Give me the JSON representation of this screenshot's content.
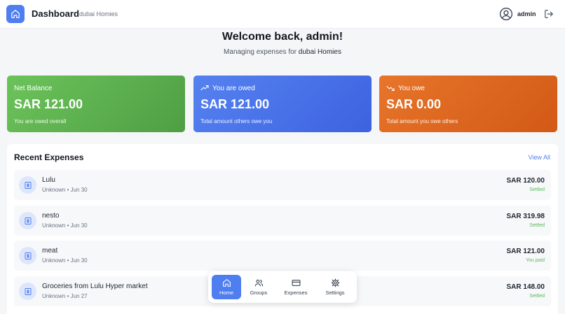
{
  "header": {
    "title": "Dashboard",
    "group_name": "dubai Homies",
    "user_name": "admin"
  },
  "welcome": {
    "heading": "Welcome back, admin!",
    "managing_prefix": "Managing expenses for",
    "group_name": "dubai Homies"
  },
  "cards": [
    {
      "title": "Net Balance",
      "amount": "SAR 121.00",
      "subtitle": "You are owed overall",
      "color": "#5cb050"
    },
    {
      "title": "You are owed",
      "amount": "SAR 121.00",
      "subtitle": "Total amount others owe you",
      "icon": "trending-up-icon",
      "color": "#4a73ea"
    },
    {
      "title": "You owe",
      "amount": "SAR 0.00",
      "subtitle": "Total amount you owe others",
      "icon": "trending-down-icon",
      "color": "#dd661f"
    }
  ],
  "recent": {
    "title": "Recent Expenses",
    "view_all": "View All",
    "items": [
      {
        "name": "Lulu",
        "payer": "Unknown",
        "date": "Jun 30",
        "amount": "SAR 120.00",
        "status": "Settled"
      },
      {
        "name": "nesto",
        "payer": "Unknown",
        "date": "Jun 30",
        "amount": "SAR 319.98",
        "status": "Settled"
      },
      {
        "name": "meat",
        "payer": "Unknown",
        "date": "Jun 30",
        "amount": "SAR 121.00",
        "status": "You paid"
      },
      {
        "name": "Groceries from Lulu Hyper market",
        "payer": "Unknown",
        "date": "Jun 27",
        "amount": "SAR 148.00",
        "status": "Settled"
      }
    ]
  },
  "nav": [
    {
      "label": "Home",
      "icon": "home-icon",
      "active": true
    },
    {
      "label": "Groups",
      "icon": "users-icon",
      "active": false
    },
    {
      "label": "Expenses",
      "icon": "credit-card-icon",
      "active": false
    },
    {
      "label": "Settings",
      "icon": "gear-icon",
      "active": false
    }
  ],
  "colors": {
    "accent": "#4f7ef0",
    "success": "#5cb85c"
  }
}
